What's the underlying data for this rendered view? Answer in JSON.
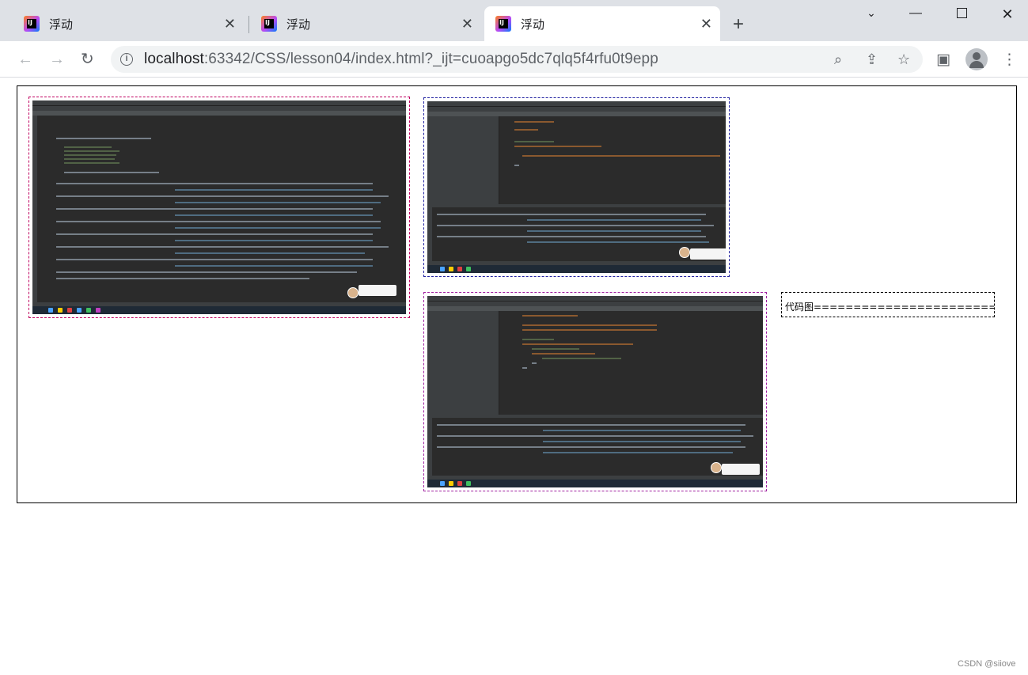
{
  "browser": {
    "tabs": [
      {
        "title": "浮动",
        "active": false
      },
      {
        "title": "浮动",
        "active": false
      },
      {
        "title": "浮动",
        "active": true
      }
    ],
    "new_tab_icon": "plus-icon",
    "url_host": "localhost",
    "url_rest": ":63342/CSS/lesson04/index.html?_ijt=cuoapgo5dc7qlq5f4rfu0t9epp",
    "window_controls": [
      "chevron-down-icon",
      "minimize-icon",
      "maximize-icon",
      "close-icon"
    ]
  },
  "page": {
    "images": [
      {
        "alt": "IntelliJ IDEA console screenshot"
      },
      {
        "alt": "IntelliJ IDEA editor screenshot"
      },
      {
        "alt": "IntelliJ IDEA controller code screenshot"
      }
    ],
    "code_label": "代码图==========================="
  },
  "watermark": "CSDN @siiove",
  "colors": {
    "tabbar_bg": "#dee1e6",
    "ide_bg": "#2b2b2b",
    "border1": "#c00060",
    "border2": "#2020a0",
    "border3": "#a020a0"
  }
}
